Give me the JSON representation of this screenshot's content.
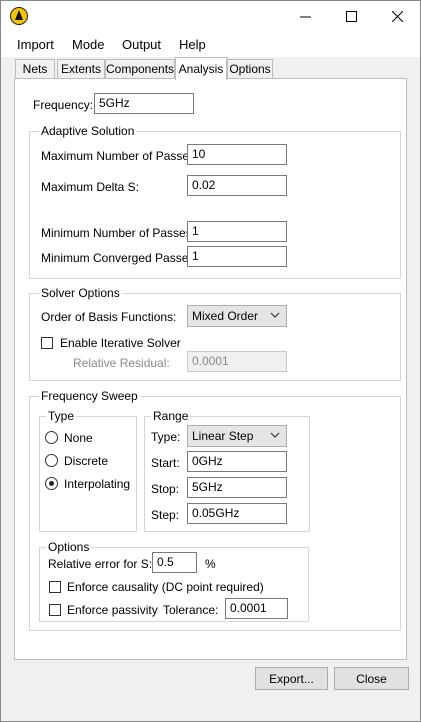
{
  "window": {
    "controls": {
      "minimize": "minimize",
      "maximize": "maximize",
      "close": "close"
    }
  },
  "menu": [
    "Import",
    "Mode",
    "Output",
    "Help"
  ],
  "tabs": [
    "Nets",
    "Extents",
    "Components",
    "Analysis",
    "Options"
  ],
  "analysis": {
    "frequency_label": "Frequency:",
    "frequency_value": "5GHz",
    "adaptive": {
      "title": "Adaptive Solution",
      "max_passes_label": "Maximum Number of Passes:",
      "max_passes_value": "10",
      "max_delta_label": "Maximum Delta S:",
      "max_delta_value": "0.02",
      "min_passes_label": "Minimum Number of Passes:",
      "min_passes_value": "1",
      "min_conv_label": "Minimum Converged Passes:",
      "min_conv_value": "1"
    },
    "solver": {
      "title": "Solver Options",
      "order_label": "Order of Basis Functions:",
      "order_value": "Mixed Order",
      "iterative_label": "Enable Iterative Solver",
      "residual_label": "Relative Residual:",
      "residual_value": "0.0001"
    },
    "sweep": {
      "title": "Frequency Sweep",
      "type_title": "Type",
      "type_options": [
        "None",
        "Discrete",
        "Interpolating"
      ],
      "type_selected": "Interpolating",
      "range_title": "Range",
      "range_type_label": "Type:",
      "range_type_value": "Linear Step",
      "start_label": "Start:",
      "start_value": "0GHz",
      "stop_label": "Stop:",
      "stop_value": "5GHz",
      "step_label": "Step:",
      "step_value": "0.05GHz",
      "options_title": "Options",
      "rel_error_label": "Relative error for S:",
      "rel_error_value": "0.5",
      "rel_error_unit": "%",
      "causality_label": "Enforce causality (DC point required)",
      "passivity_label": "Enforce passivity",
      "tolerance_label": "Tolerance:",
      "tolerance_value": "0.0001"
    }
  },
  "buttons": {
    "export": "Export...",
    "close": "Close"
  },
  "colors": {
    "app_icon": "#f5c400",
    "window_bg": "#f0f0f0",
    "panel_bg": "#ffffff",
    "group_border": "#d5d5d5"
  }
}
